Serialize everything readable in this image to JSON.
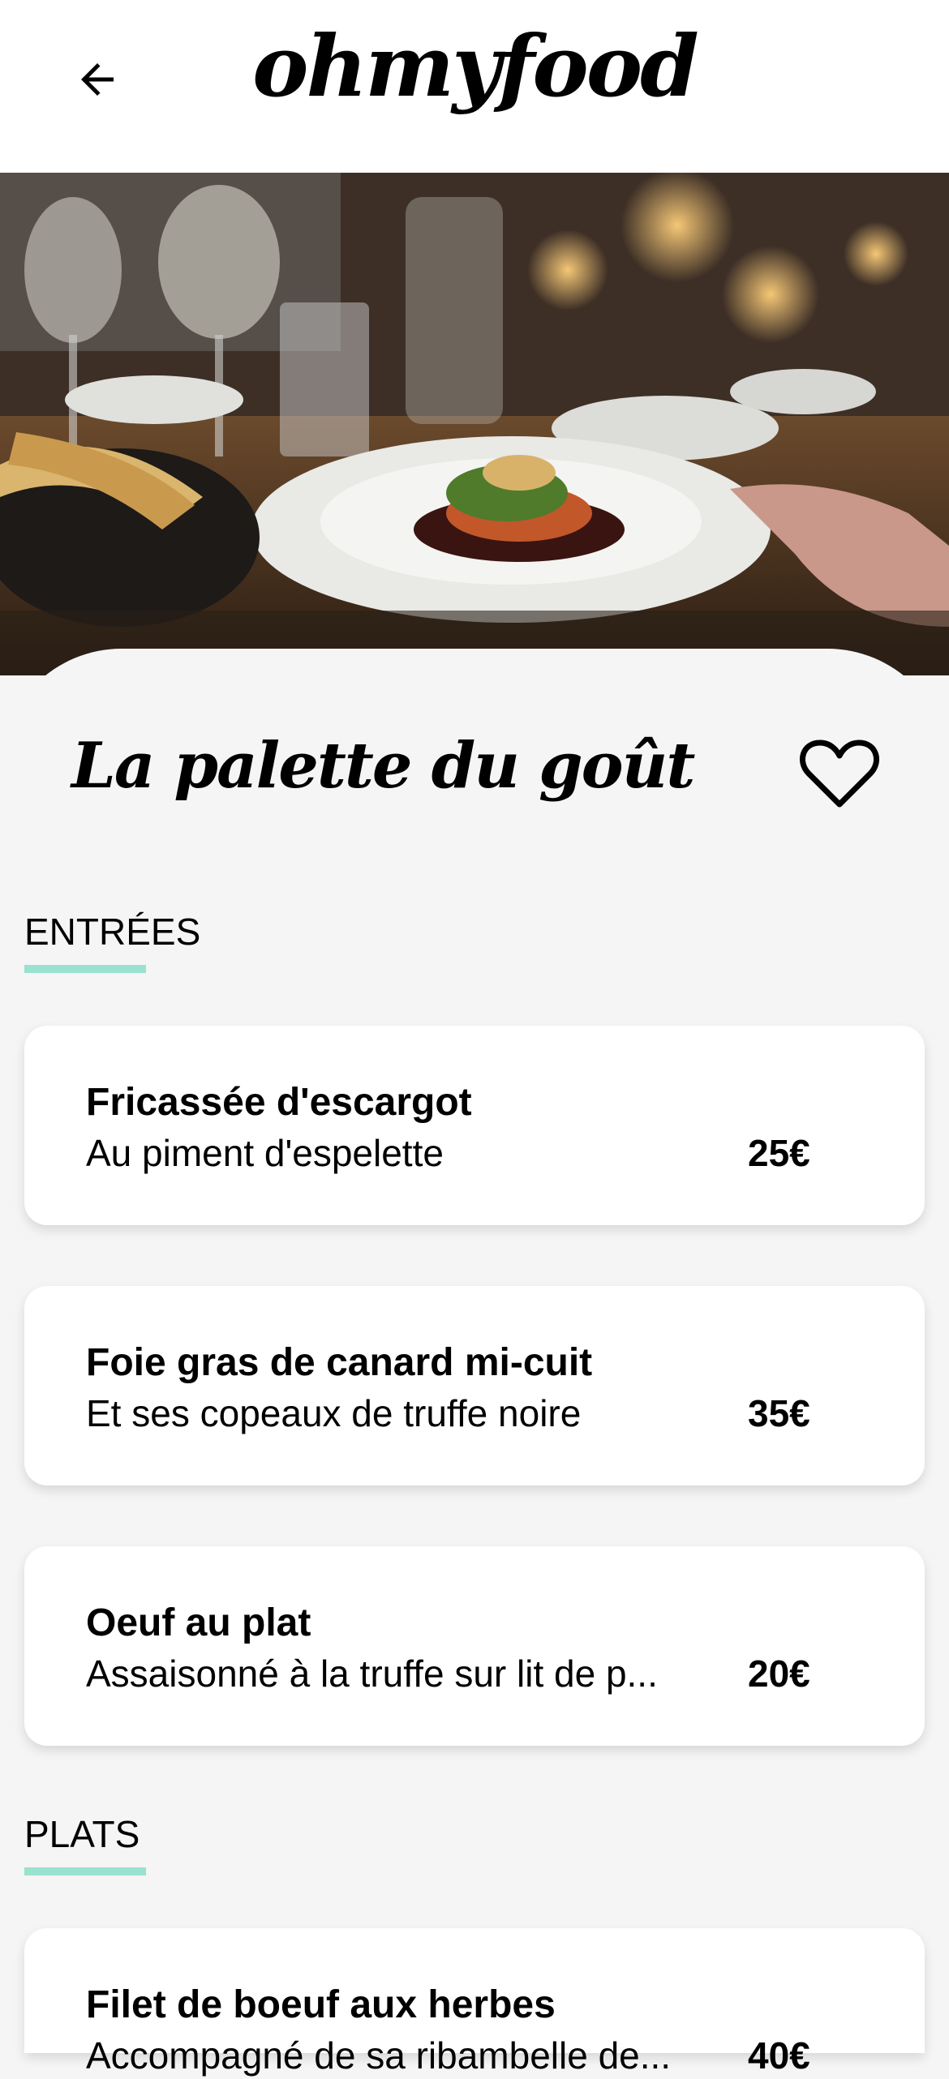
{
  "header": {
    "logo": "ohmyfood",
    "back_icon": "arrow-left-icon"
  },
  "restaurant": {
    "name": "La palette du goût",
    "favorite_icon": "heart-outline-icon"
  },
  "sections": [
    {
      "title": "ENTRÉES",
      "items": [
        {
          "name": "Fricassée d'escargot",
          "description": "Au piment d'espelette",
          "price": "25€"
        },
        {
          "name": "Foie gras de canard mi-cuit",
          "description": "Et ses copeaux de truffe noire",
          "price": "35€"
        },
        {
          "name": "Oeuf au plat",
          "description": "Assaisonné à la truffe sur lit de p...",
          "price": "20€"
        }
      ]
    },
    {
      "title": "PLATS",
      "items": [
        {
          "name": "Filet de boeuf aux herbes",
          "description": "Accompagné de sa ribambelle de...",
          "price": "40€"
        }
      ]
    }
  ],
  "colors": {
    "accent": "#99e2d0",
    "background": "#f5f5f5",
    "card": "#ffffff"
  }
}
